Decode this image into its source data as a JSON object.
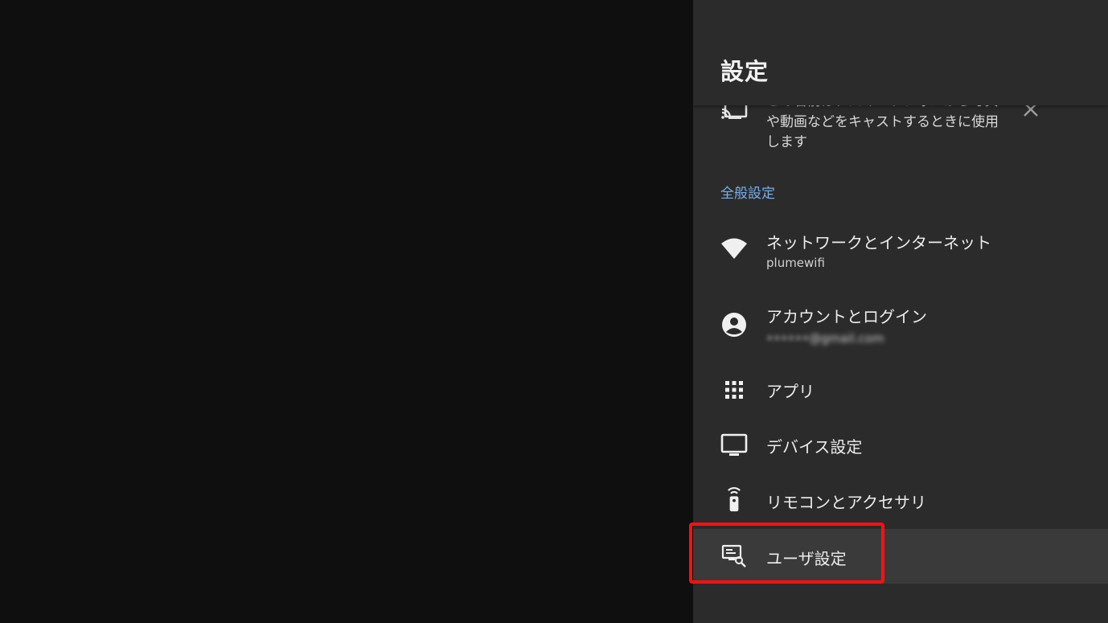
{
  "panel": {
    "title": "設定"
  },
  "notice": {
    "text": "この名前は、スマートフォンから写真や動画などをキャストするときに使用します",
    "close_label": "✕"
  },
  "section": {
    "label": "全般設定"
  },
  "items": [
    {
      "label": "ネットワークとインターネット",
      "sub": "plumewifi",
      "icon": "wifi-icon"
    },
    {
      "label": "アカウントとログイン",
      "sub": "••••••@gmail.com",
      "icon": "account-circle-icon"
    },
    {
      "label": "アプリ",
      "icon": "apps-grid-icon"
    },
    {
      "label": "デバイス設定",
      "icon": "tv-icon"
    },
    {
      "label": "リモコンとアクセサリ",
      "icon": "remote-icon"
    },
    {
      "label": "ユーザ設定",
      "icon": "preferences-icon",
      "selected": true
    }
  ],
  "colors": {
    "panel_bg": "#2b2b2c",
    "left_bg": "#0f0f0f",
    "section_label": "#79aee8",
    "selected_bg": "#3a3a3b",
    "highlight": "#ff1010"
  }
}
